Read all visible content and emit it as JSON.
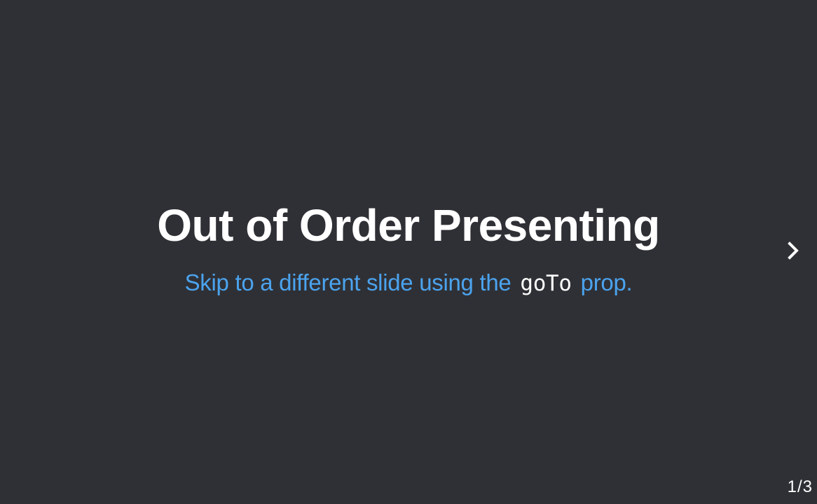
{
  "slide": {
    "title": "Out of Order Presenting",
    "subtitle_before": "Skip to a different slide using the",
    "subtitle_code": "goTo",
    "subtitle_after": "prop."
  },
  "navigation": {
    "next_icon": "chevron-right-icon",
    "current_page": "1",
    "page_separator": "/",
    "total_pages": "3"
  },
  "colors": {
    "background": "#2f3035",
    "title": "#ffffff",
    "subtitle": "#4ba3ee",
    "code": "#ffffff"
  }
}
